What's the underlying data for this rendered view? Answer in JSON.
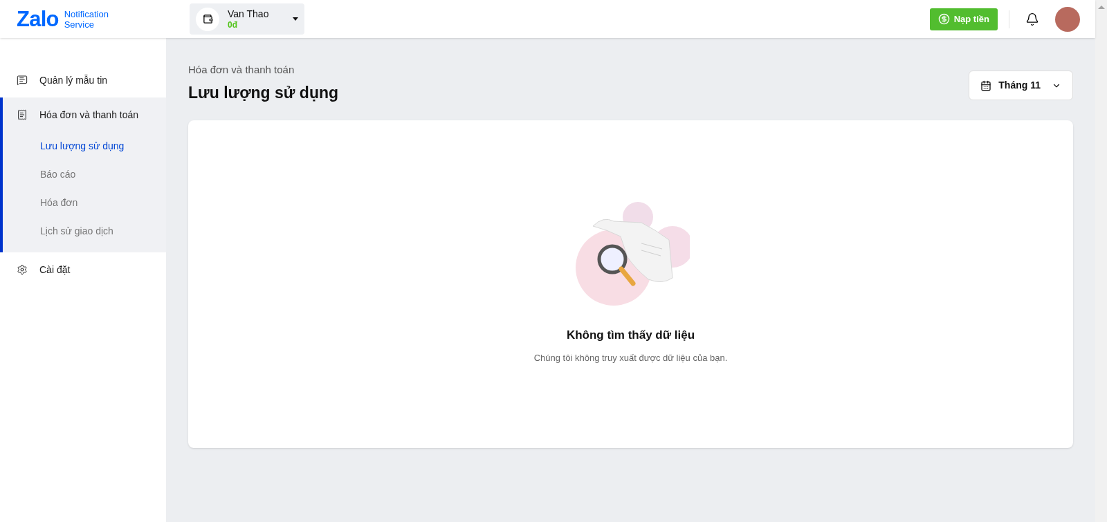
{
  "logo": {
    "brand": "Zalo",
    "product_line1": "Notification",
    "product_line2": "Service"
  },
  "account": {
    "name": "Van Thao",
    "balance": "0đ"
  },
  "topup_button": "Nạp tiền",
  "sidebar": {
    "items": [
      {
        "label": "Quản lý mẫu tin",
        "selected": false
      },
      {
        "label": "Hóa đơn và thanh toán",
        "selected": true,
        "children": [
          {
            "label": "Lưu lượng sử dụng",
            "selected": true
          },
          {
            "label": "Báo cáo",
            "selected": false
          },
          {
            "label": "Hóa đơn",
            "selected": false
          },
          {
            "label": "Lịch sử giao dịch",
            "selected": false
          }
        ]
      },
      {
        "label": "Cài đặt",
        "selected": false
      }
    ]
  },
  "page": {
    "breadcrumb": "Hóa đơn và thanh toán",
    "title": "Lưu lượng sử dụng",
    "month_picker": "Tháng 11"
  },
  "empty_state": {
    "title": "Không tìm thấy dữ liệu",
    "message": "Chúng tôi không truy xuất được dữ liệu của bạn."
  }
}
